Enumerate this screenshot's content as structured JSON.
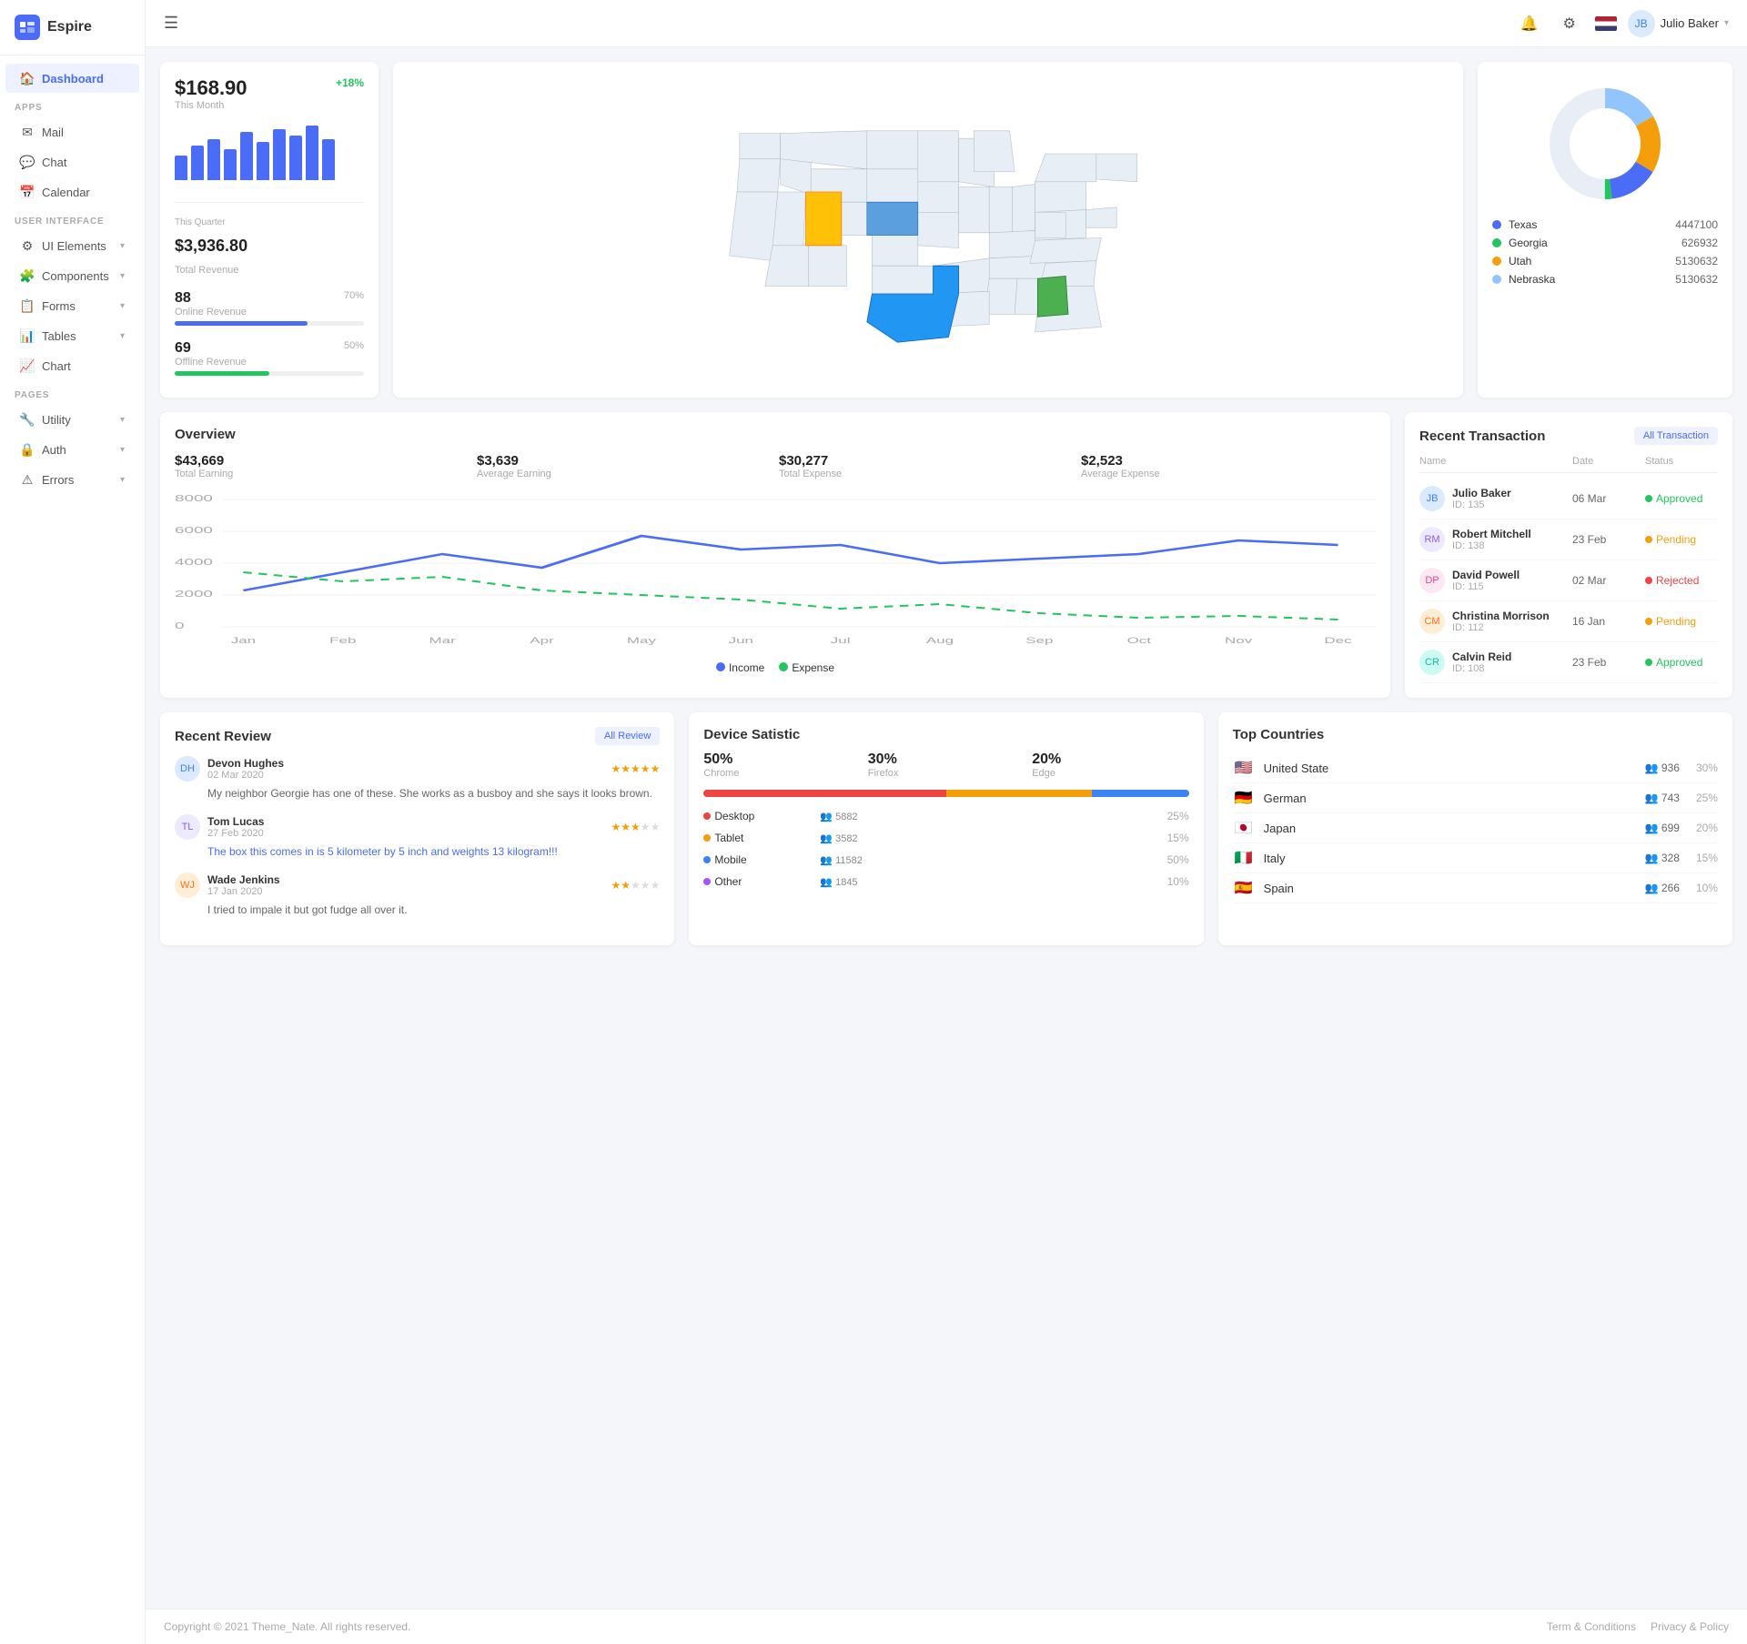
{
  "sidebar": {
    "logo": "Espire",
    "dashboard": "Dashboard",
    "sections": [
      {
        "label": "APPS",
        "items": [
          {
            "id": "mail",
            "icon": "✉",
            "label": "Mail",
            "arrow": false
          },
          {
            "id": "chat",
            "icon": "💬",
            "label": "Chat",
            "arrow": false
          },
          {
            "id": "calendar",
            "icon": "📅",
            "label": "Calendar",
            "arrow": false
          }
        ]
      },
      {
        "label": "USER INTERFACE",
        "items": [
          {
            "id": "ui-elements",
            "icon": "⚙",
            "label": "UI Elements",
            "arrow": true
          },
          {
            "id": "components",
            "icon": "🧩",
            "label": "Components",
            "arrow": true
          },
          {
            "id": "forms",
            "icon": "📋",
            "label": "Forms",
            "arrow": true
          },
          {
            "id": "tables",
            "icon": "📊",
            "label": "Tables",
            "arrow": true
          },
          {
            "id": "chart",
            "icon": "📈",
            "label": "Chart",
            "arrow": false
          }
        ]
      },
      {
        "label": "PAGES",
        "items": [
          {
            "id": "utility",
            "icon": "🔧",
            "label": "Utility",
            "arrow": true
          },
          {
            "id": "auth",
            "icon": "🔒",
            "label": "Auth",
            "arrow": true
          },
          {
            "id": "errors",
            "icon": "⚠",
            "label": "Errors",
            "arrow": true
          }
        ]
      }
    ]
  },
  "header": {
    "menu_icon": "☰",
    "user_name": "Julio Baker",
    "notification_icon": "🔔",
    "settings_icon": "⚙"
  },
  "stats_card": {
    "amount": "$168.90",
    "period": "This Month",
    "badge": "+18%",
    "bars": [
      30,
      45,
      55,
      40,
      65,
      50,
      70,
      60,
      75,
      55
    ],
    "quarter_label": "This Quarter",
    "quarter_amount": "$3,936.80",
    "quarter_sublabel": "Total Revenue",
    "online_value": "88",
    "online_label": "Online Revenue",
    "online_pct": "70%",
    "online_pct_num": 70,
    "offline_value": "69",
    "offline_label": "Offline Revenue",
    "offline_pct": "50%",
    "offline_pct_num": 50
  },
  "donut_card": {
    "legend": [
      {
        "name": "Texas",
        "value": "4447100",
        "color": "#4a6cf7"
      },
      {
        "name": "Georgia",
        "value": "626932",
        "color": "#22c55e"
      },
      {
        "name": "Utah",
        "value": "5130632",
        "color": "#f59e0b"
      },
      {
        "name": "Nebraska",
        "value": "5130632",
        "color": "#93c5fd"
      }
    ]
  },
  "overview": {
    "title": "Overview",
    "stats": [
      {
        "value": "$43,669",
        "label": "Total Earning"
      },
      {
        "value": "$3,639",
        "label": "Average Earning"
      },
      {
        "value": "$30,277",
        "label": "Total Expense"
      },
      {
        "value": "$2,523",
        "label": "Average Expense"
      }
    ],
    "y_axis": [
      "8000",
      "6000",
      "4000",
      "2000",
      "0"
    ],
    "x_axis": [
      "Jan",
      "Feb",
      "Mar",
      "Apr",
      "May",
      "Jun",
      "Jul",
      "Aug",
      "Sep",
      "Oct",
      "Nov",
      "Dec"
    ],
    "legend_income": "Income",
    "legend_expense": "Expense"
  },
  "transactions": {
    "title": "Recent Transaction",
    "all_btn": "All Transaction",
    "cols": [
      "Name",
      "Date",
      "Status"
    ],
    "rows": [
      {
        "name": "Julio Baker",
        "id": "ID: 135",
        "date": "06 Mar",
        "status": "Approved",
        "status_type": "approved",
        "av_color": "av-blue"
      },
      {
        "name": "Robert Mitchell",
        "id": "ID: 138",
        "date": "23 Feb",
        "status": "Pending",
        "status_type": "pending",
        "av_color": "av-purple"
      },
      {
        "name": "David Powell",
        "id": "ID: 115",
        "date": "02 Mar",
        "status": "Rejected",
        "status_type": "rejected",
        "av_color": "av-pink"
      },
      {
        "name": "Christina Morrison",
        "id": "ID: 112",
        "date": "16 Jan",
        "status": "Pending",
        "status_type": "pending",
        "av_color": "av-orange"
      },
      {
        "name": "Calvin Reid",
        "id": "ID: 108",
        "date": "23 Feb",
        "status": "Approved",
        "status_type": "approved",
        "av_color": "av-teal"
      }
    ]
  },
  "reviews": {
    "title": "Recent Review",
    "all_btn": "All Review",
    "items": [
      {
        "name": "Devon Hughes",
        "date": "02 Mar 2020",
        "stars": 5,
        "text": "My neighbor Georgie has one of these. She works as a busboy and she says it looks brown.",
        "highlighted": false,
        "av_color": "av-blue"
      },
      {
        "name": "Tom Lucas",
        "date": "27 Feb 2020",
        "stars": 3,
        "text": "The box this comes in is 5 kilometer by 5 inch and weights 13 kilogram!!!",
        "highlighted": true,
        "av_color": "av-purple"
      },
      {
        "name": "Wade Jenkins",
        "date": "17 Jan 2020",
        "stars": 2,
        "text": "I tried to impale it but got fudge all over it.",
        "highlighted": false,
        "av_color": "av-orange"
      }
    ]
  },
  "device_stats": {
    "title": "Device Satistic",
    "chrome_pct": "50%",
    "chrome_label": "Chrome",
    "firefox_pct": "30%",
    "firefox_label": "Firefox",
    "edge_pct": "20%",
    "edge_label": "Edge",
    "bar_chrome": 50,
    "bar_firefox": 30,
    "bar_edge": 20,
    "devices": [
      {
        "name": "Desktop",
        "color": "#ef4444",
        "users": "5882",
        "pct": "25%"
      },
      {
        "name": "Tablet",
        "color": "#f59e0b",
        "users": "3582",
        "pct": "15%"
      },
      {
        "name": "Mobile",
        "color": "#3b82f6",
        "users": "11582",
        "pct": "50%"
      },
      {
        "name": "Other",
        "color": "#a855f7",
        "users": "1845",
        "pct": "10%"
      }
    ]
  },
  "top_countries": {
    "title": "Top Countries",
    "countries": [
      {
        "name": "United State",
        "flag": "🇺🇸",
        "users": "936",
        "pct": "30%"
      },
      {
        "name": "German",
        "flag": "🇩🇪",
        "users": "743",
        "pct": "25%"
      },
      {
        "name": "Japan",
        "flag": "🇯🇵",
        "users": "699",
        "pct": "20%"
      },
      {
        "name": "Italy",
        "flag": "🇮🇹",
        "users": "328",
        "pct": "15%"
      },
      {
        "name": "Spain",
        "flag": "🇪🇸",
        "users": "266",
        "pct": "10%"
      }
    ]
  },
  "footer": {
    "copyright": "Copyright © 2021 Theme_Nate. All rights reserved.",
    "links": [
      "Term & Conditions",
      "Privacy & Policy"
    ]
  }
}
